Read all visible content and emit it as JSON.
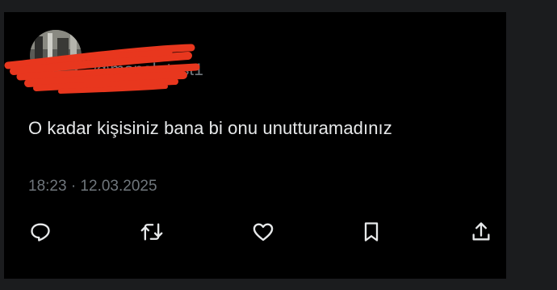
{
  "tweet": {
    "handle": "@monab test1",
    "text": "O kadar kişisiniz bana bi onu unutturamadınız",
    "timestamp": "18:23 · 12.03.2025"
  },
  "actions": {
    "reply": "reply-icon",
    "retweet": "retweet-icon",
    "like": "heart-icon",
    "bookmark": "bookmark-icon",
    "share": "share-icon"
  },
  "colors": {
    "background": "#000000",
    "text": "#e7e9ea",
    "muted": "#6f767c",
    "redaction": "#e8371e"
  }
}
